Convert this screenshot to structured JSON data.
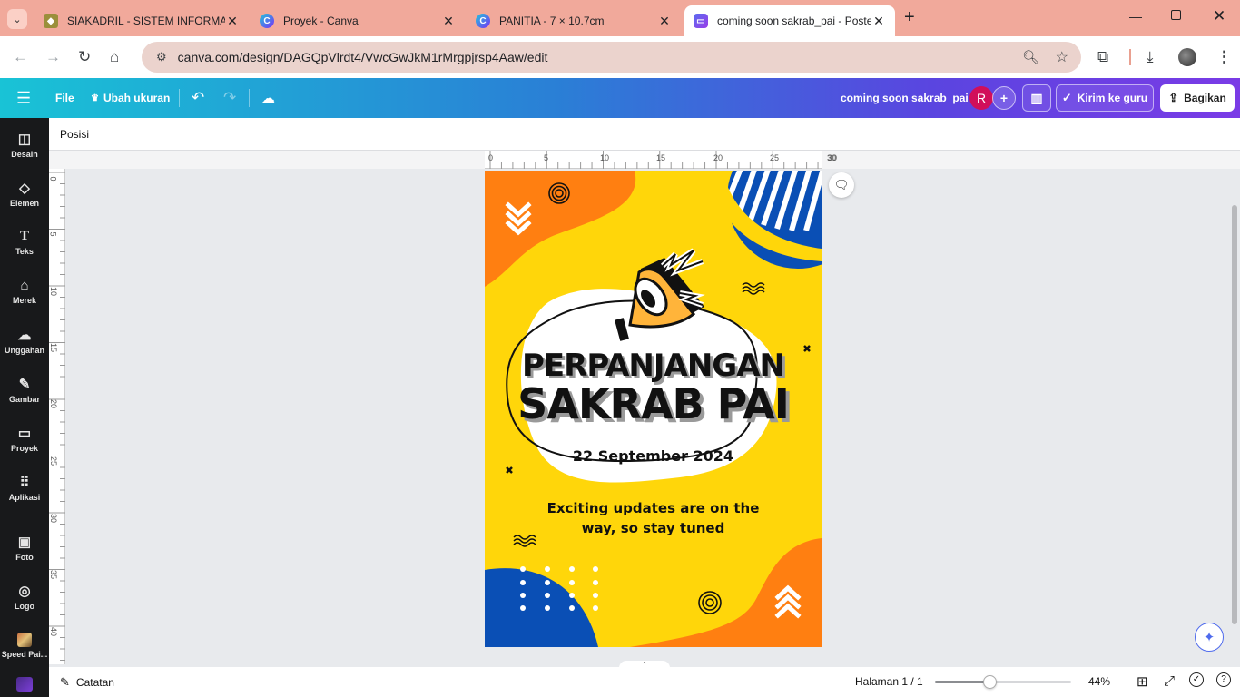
{
  "browser": {
    "tabs": [
      {
        "title": "SIAKADRIL - SISTEM INFORMASI",
        "active": false
      },
      {
        "title": "Proyek - Canva",
        "active": false
      },
      {
        "title": "PANITIA - 7 × 10.7cm",
        "active": false
      },
      {
        "title": "coming soon sakrab_pai - Poster",
        "active": true
      }
    ],
    "new_tab": "+",
    "url": "canva.com/design/DAGQpVlrdt4/VwcGwJkM1rMrgpjrsp4Aaw/edit"
  },
  "canva_header": {
    "menu_icon": "hamburger-icon",
    "file_label": "File",
    "resize_label": "Ubah ukuran",
    "design_title": "coming soon sakrab_pai",
    "avatar_letter": "R",
    "send_teacher_label": "Kirim ke guru",
    "share_label": "Bagikan"
  },
  "sidebar": {
    "items": [
      {
        "label": "Desain",
        "icon": "layout-icon"
      },
      {
        "label": "Elemen",
        "icon": "shapes-icon"
      },
      {
        "label": "Teks",
        "icon": "text-icon"
      },
      {
        "label": "Merek",
        "icon": "brand-icon"
      },
      {
        "label": "Unggahan",
        "icon": "upload-cloud-icon"
      },
      {
        "label": "Gambar",
        "icon": "draw-icon"
      },
      {
        "label": "Proyek",
        "icon": "folder-icon"
      },
      {
        "label": "Aplikasi",
        "icon": "apps-grid-icon"
      },
      {
        "label": "Foto",
        "icon": "photo-icon"
      },
      {
        "label": "Logo",
        "icon": "logo-icon"
      },
      {
        "label": "Speed Pai...",
        "icon": "app-thumbnail-icon"
      }
    ]
  },
  "context_bar": {
    "position_label": "Posisi"
  },
  "ruler": {
    "horizontal": [
      "0",
      "5",
      "10",
      "15",
      "20",
      "25",
      "30"
    ],
    "vertical": [
      "0",
      "5",
      "10",
      "15",
      "20",
      "25",
      "30",
      "35",
      "40"
    ]
  },
  "poster": {
    "headline_line1": "PERPANJANGAN",
    "headline_line2": "SAKRAB PAI",
    "date": "22 September 2024",
    "tagline_line1": "Exciting updates are on the",
    "tagline_line2": "way, so stay tuned"
  },
  "bottom_bar": {
    "notes_label": "Catatan",
    "page_label": "Halaman 1 / 1",
    "zoom_label": "44%",
    "zoom_fraction": 0.4
  },
  "colors": {
    "poster_yellow": "#ffd60a",
    "poster_orange": "#ff7f11",
    "poster_blue": "#0a4fb5",
    "sidebar_bg": "#18191b",
    "tab_strip": "#f1a99b"
  }
}
